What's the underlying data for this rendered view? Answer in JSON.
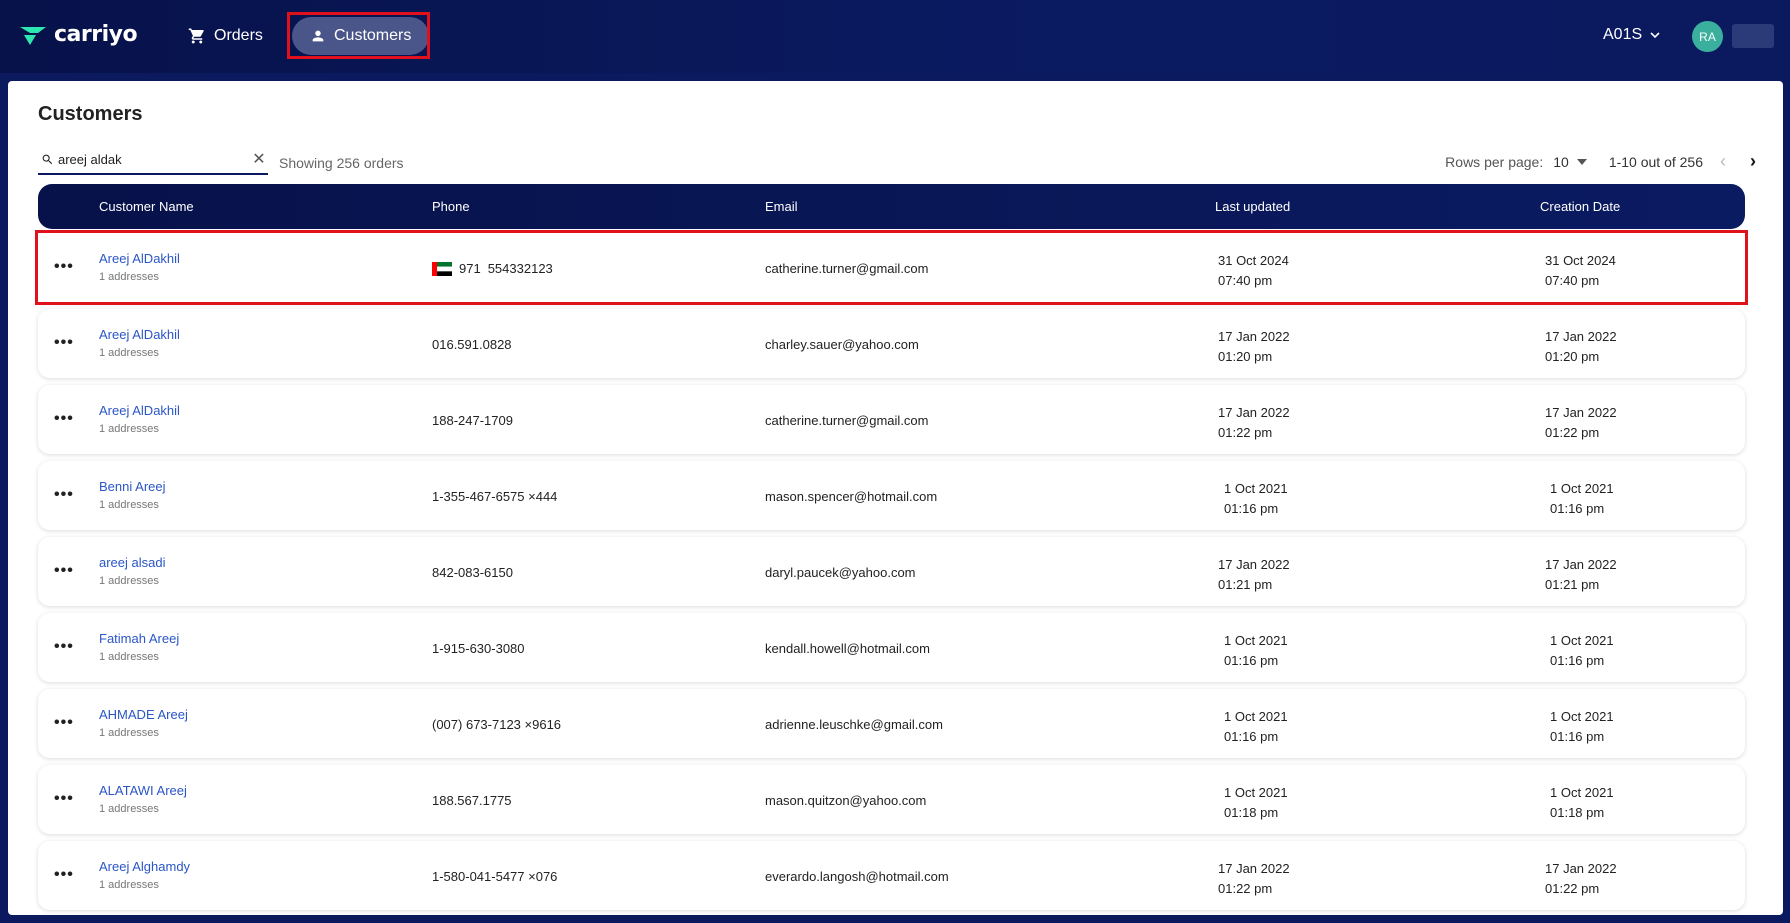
{
  "header": {
    "logo_text": "carriyo",
    "nav": [
      {
        "label": "Orders",
        "icon": "cart-icon"
      },
      {
        "label": "Customers",
        "icon": "person-icon"
      }
    ],
    "account": "A01S",
    "avatar_initials": "RA"
  },
  "page": {
    "title": "Customers",
    "search_value": "areej aldak",
    "showing_text": "Showing 256 orders",
    "rows_per_page_label": "Rows per page:",
    "rows_per_page_value": "10",
    "page_range": "1-10 out of 256"
  },
  "table": {
    "columns": [
      "Customer Name",
      "Phone",
      "Email",
      "Last updated",
      "Creation Date"
    ],
    "rows": [
      {
        "name": "Areej AlDakhil",
        "addresses": "1 addresses",
        "phone_code": "971",
        "phone": "554332123",
        "email": "catherine.turner@gmail.com",
        "updated_date": "31 Oct 2024",
        "updated_time": "07:40 pm",
        "created_date": "31 Oct 2024",
        "created_time": "07:40 pm"
      },
      {
        "name": "Areej AlDakhil",
        "addresses": "1 addresses",
        "phone": "016.591.0828",
        "email": "charley.sauer@yahoo.com",
        "updated_date": "17 Jan 2022",
        "updated_time": "01:20 pm",
        "created_date": "17 Jan 2022",
        "created_time": "01:20 pm"
      },
      {
        "name": "Areej AlDakhil",
        "addresses": "1 addresses",
        "phone": "188-247-1709",
        "email": "catherine.turner@gmail.com",
        "updated_date": "17 Jan 2022",
        "updated_time": "01:22 pm",
        "created_date": "17 Jan 2022",
        "created_time": "01:22 pm"
      },
      {
        "name": "Benni Areej",
        "addresses": "1 addresses",
        "phone": "1-355-467-6575 ×444",
        "email": "mason.spencer@hotmail.com",
        "updated_date": "1 Oct 2021",
        "updated_time": "01:16 pm",
        "created_date": "1 Oct 2021",
        "created_time": "01:16 pm"
      },
      {
        "name": "areej alsadi",
        "addresses": "1 addresses",
        "phone": "842-083-6150",
        "email": "daryl.paucek@yahoo.com",
        "updated_date": "17 Jan 2022",
        "updated_time": "01:21 pm",
        "created_date": "17 Jan 2022",
        "created_time": "01:21 pm"
      },
      {
        "name": "Fatimah Areej",
        "addresses": "1 addresses",
        "phone": "1-915-630-3080",
        "email": "kendall.howell@hotmail.com",
        "updated_date": "1 Oct 2021",
        "updated_time": "01:16 pm",
        "created_date": "1 Oct 2021",
        "created_time": "01:16 pm"
      },
      {
        "name": "AHMADE Areej",
        "addresses": "1 addresses",
        "phone": "(007) 673-7123 ×9616",
        "email": "adrienne.leuschke@gmail.com",
        "updated_date": "1 Oct 2021",
        "updated_time": "01:16 pm",
        "created_date": "1 Oct 2021",
        "created_time": "01:16 pm"
      },
      {
        "name": "ALATAWI Areej",
        "addresses": "1 addresses",
        "phone": "188.567.1775",
        "email": "mason.quitzon@yahoo.com",
        "updated_date": "1 Oct 2021",
        "updated_time": "01:18 pm",
        "created_date": "1 Oct 2021",
        "created_time": "01:18 pm"
      },
      {
        "name": "Areej Alghamdy",
        "addresses": "1 addresses",
        "phone": "1-580-041-5477 ×076",
        "email": "everardo.langosh@hotmail.com",
        "updated_date": "17 Jan 2022",
        "updated_time": "01:22 pm",
        "created_date": "17 Jan 2022",
        "created_time": "01:22 pm"
      }
    ]
  },
  "colors": {
    "header_bg": "#0b1a5e",
    "link": "#2a56c6",
    "highlight": "#e0111a",
    "avatar": "#3aaf9e"
  }
}
